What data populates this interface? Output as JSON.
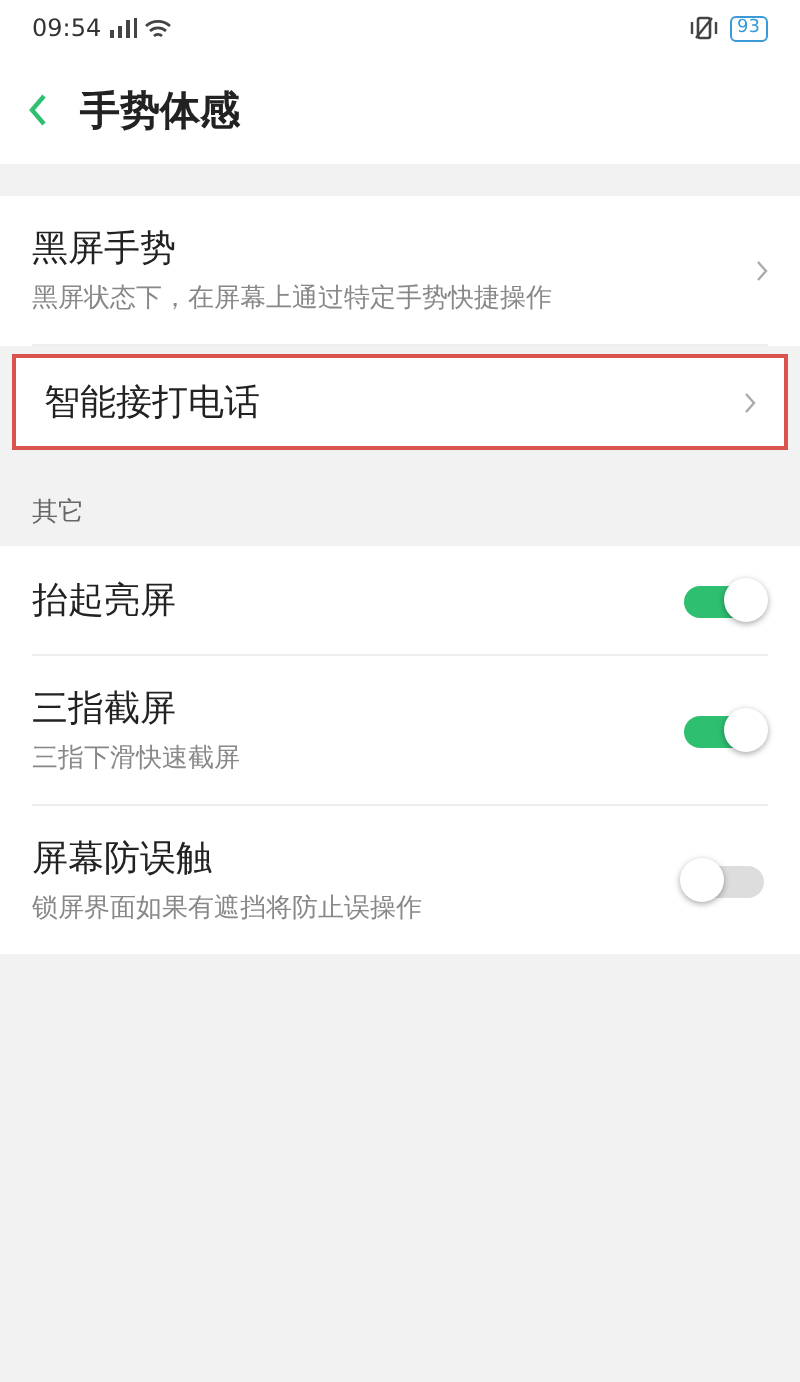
{
  "status_bar": {
    "time": "09:54",
    "battery": "93"
  },
  "header": {
    "title": "手势体感"
  },
  "groups": [
    {
      "items": [
        {
          "kind": "link",
          "title": "黑屏手势",
          "subtitle": "黑屏状态下，在屏幕上通过特定手势快捷操作",
          "highlighted": false
        },
        {
          "kind": "link",
          "title": "智能接打电话",
          "highlighted": true
        }
      ]
    },
    {
      "heading": "其它",
      "items": [
        {
          "kind": "toggle",
          "title": "抬起亮屏",
          "on": true
        },
        {
          "kind": "toggle",
          "title": "三指截屏",
          "subtitle": "三指下滑快速截屏",
          "on": true
        },
        {
          "kind": "toggle",
          "title": "屏幕防误触",
          "subtitle": "锁屏界面如果有遮挡将防止误操作",
          "on": false
        }
      ]
    }
  ]
}
